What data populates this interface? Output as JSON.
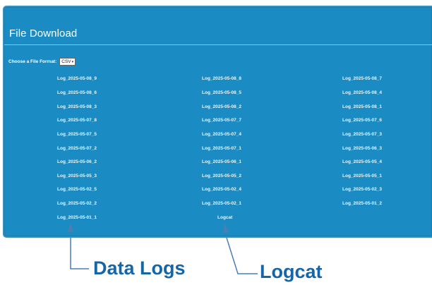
{
  "panel": {
    "title": "File Download",
    "format_label": "Choose a File Format:",
    "format_value": "CSV"
  },
  "logs": {
    "column_1": [
      "Log_2025-05-08_9",
      "Log_2025-05-08_6",
      "Log_2025-05-08_3",
      "Log_2025-05-07_8",
      "Log_2025-05-07_5",
      "Log_2025-05-07_2",
      "Log_2025-05-06_2",
      "Log_2025-05-05_3",
      "Log_2025-05-02_5",
      "Log_2025-05-02_2",
      "Log_2025-05-01_1"
    ],
    "column_2": [
      "Log_2025-05-08_8",
      "Log_2025-05-08_5",
      "Log_2025-05-08_2",
      "Log_2025-05-07_7",
      "Log_2025-05-07_4",
      "Log_2025-05-07_1",
      "Log_2025-05-06_1",
      "Log_2025-05-05_2",
      "Log_2025-05-02_4",
      "Log_2025-05-02_1",
      "Logcat"
    ],
    "column_3": [
      "Log_2025-05-08_7",
      "Log_2025-05-08_4",
      "Log_2025-05-08_1",
      "Log_2025-05-07_6",
      "Log_2025-05-07_3",
      "Log_2025-05-06_3",
      "Log_2025-05-05_4",
      "Log_2025-05-05_1",
      "Log_2025-05-02_3",
      "Log_2025-05-01_2"
    ]
  },
  "callouts": {
    "data_logs": "Data Logs",
    "logcat": "Logcat"
  },
  "colors": {
    "panel_background": "#1a8bc3",
    "callout_text": "#1565a9",
    "callout_line": "#4a7fb5"
  }
}
